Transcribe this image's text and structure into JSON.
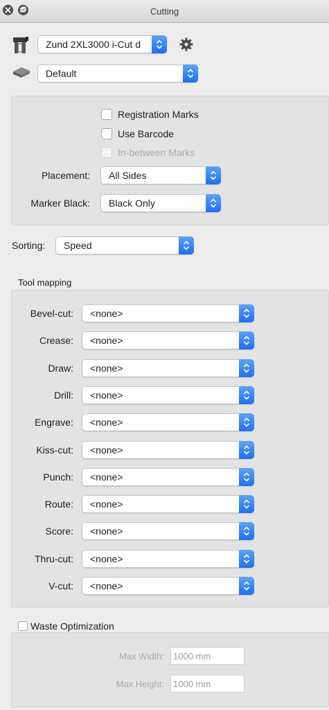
{
  "window": {
    "title": "Cutting"
  },
  "device": {
    "selected": "Zund 2XL3000 i-Cut d"
  },
  "profile": {
    "selected": "Default"
  },
  "marks": {
    "registration_marks": "Registration Marks",
    "use_barcode": "Use Barcode",
    "in_between_marks": "In-between Marks",
    "placement_label": "Placement:",
    "placement_value": "All Sides",
    "marker_black_label": "Marker Black:",
    "marker_black_value": "Black Only"
  },
  "sorting": {
    "label": "Sorting:",
    "value": "Speed"
  },
  "tool_mapping": {
    "title": "Tool mapping",
    "rows": [
      {
        "label": "Bevel-cut:",
        "value": "<none>"
      },
      {
        "label": "Crease:",
        "value": "<none>"
      },
      {
        "label": "Draw:",
        "value": "<none>"
      },
      {
        "label": "Drill:",
        "value": "<none>"
      },
      {
        "label": "Engrave:",
        "value": "<none>"
      },
      {
        "label": "Kiss-cut:",
        "value": "<none>"
      },
      {
        "label": "Punch:",
        "value": "<none>"
      },
      {
        "label": "Route:",
        "value": "<none>"
      },
      {
        "label": "Score:",
        "value": "<none>"
      },
      {
        "label": "Thru-cut:",
        "value": "<none>"
      },
      {
        "label": "V-cut:",
        "value": "<none>"
      }
    ]
  },
  "waste": {
    "label": "Waste Optimization",
    "max_width_label": "Max Width:",
    "max_width_value": "1000 mm",
    "max_height_label": "Max Height:",
    "max_height_value": "1000 mm"
  },
  "colors": {
    "accent": "#1f6ff2",
    "panel": "#e3e3e3",
    "window": "#ececec"
  }
}
